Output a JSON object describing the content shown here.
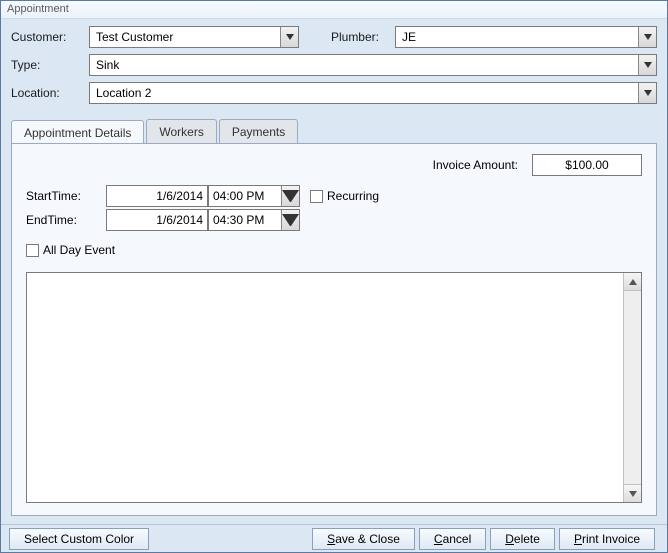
{
  "window": {
    "title": "Appointment"
  },
  "header": {
    "customer_label": "Customer:",
    "customer_value": "Test Customer",
    "plumber_label": "Plumber:",
    "plumber_value": "JE",
    "type_label": "Type:",
    "type_value": "Sink",
    "location_label": "Location:",
    "location_value": "Location 2"
  },
  "tabs": {
    "details": "Appointment Details",
    "workers": "Workers",
    "payments": "Payments",
    "active": "details"
  },
  "details": {
    "invoice_label": "Invoice Amount:",
    "invoice_value": "$100.00",
    "start_label": "StartTime:",
    "start_date": "1/6/2014",
    "start_time": "04:00 PM",
    "end_label": "EndTime:",
    "end_date": "1/6/2014",
    "end_time": "04:30 PM",
    "recurring_label": "Recurring",
    "recurring_checked": false,
    "allday_label": "All Day Event",
    "allday_checked": false,
    "notes": ""
  },
  "footer": {
    "custom_color": "Select Custom Color",
    "save_close": "Save & Close",
    "cancel": "Cancel",
    "delete": "Delete",
    "print_invoice": "Print Invoice"
  }
}
